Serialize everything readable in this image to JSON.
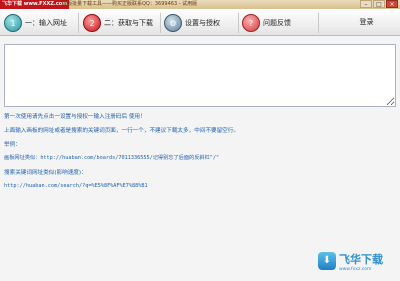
{
  "window": {
    "site_badge": "飞华下载 www.FXXZ.com",
    "title": "国版批量下载工具——购买正版联系QQ：3699463 - 试用版",
    "min": "–",
    "max": "□",
    "close": "×"
  },
  "toolbar": {
    "tabs": [
      {
        "label": "一：输入网址",
        "icon": "1"
      },
      {
        "label": "二：获取与下载",
        "icon": "2"
      },
      {
        "label": "设置与授权",
        "icon": "⚙"
      },
      {
        "label": "问题反馈",
        "icon": "?"
      }
    ],
    "login": "登录"
  },
  "main": {
    "url_input": "",
    "help": [
      "第一次使用请先点击一设置与授权一输入注册码后 使用！",
      "上面输入画板的网址或者是搜索的关键词页面，一行一个，不建议下载太多，中间不要留空行。",
      "举例：",
      "画板网址类似：http://huaban.com/boards/7011336555/记得别忘了后面的反斜杠\"/\"",
      "搜索关键词网址类似(影响速度)：",
      "http://huaban.com/search/?q=%E5%8F%AF%E7%88%B1"
    ]
  },
  "watermark": {
    "name": "飞华下载",
    "url": "www.fxxz.com"
  }
}
